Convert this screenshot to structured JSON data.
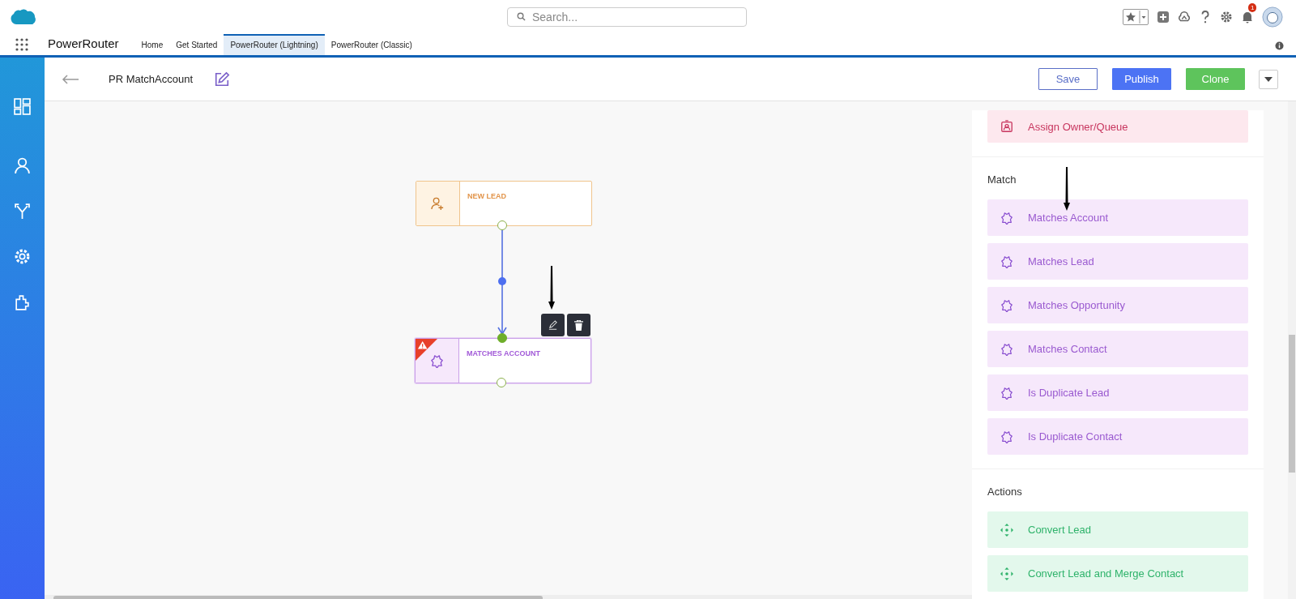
{
  "header": {
    "search_placeholder": "Search...",
    "notification_count": "1"
  },
  "nav": {
    "app_name": "PowerRouter",
    "tabs": [
      {
        "label": "Home",
        "selected": false
      },
      {
        "label": "Get Started",
        "selected": false
      },
      {
        "label": "PowerRouter (Lightning)",
        "selected": true
      },
      {
        "label": "PowerRouter (Classic)",
        "selected": false
      }
    ]
  },
  "toolbar": {
    "title": "PR MatchAccount",
    "buttons": [
      {
        "label": "Save",
        "kind": "outline"
      },
      {
        "label": "Publish",
        "kind": "primary"
      },
      {
        "label": "Clone",
        "kind": "success"
      }
    ]
  },
  "canvas": {
    "nodes": [
      {
        "label": "NEW LEAD",
        "kind": "lead",
        "warning": false,
        "selected": false
      },
      {
        "label": "MATCHES ACCOUNT",
        "kind": "match",
        "warning": true,
        "selected": true
      }
    ]
  },
  "panel": {
    "sections": [
      {
        "items": [
          {
            "label": "Assign Owner/Queue",
            "kind": "assign"
          }
        ]
      },
      {
        "title": "Match",
        "items": [
          {
            "label": "Matches Account",
            "kind": "match"
          },
          {
            "label": "Matches Lead",
            "kind": "match"
          },
          {
            "label": "Matches Opportunity",
            "kind": "match"
          },
          {
            "label": "Matches Contact",
            "kind": "match"
          },
          {
            "label": "Is Duplicate Lead",
            "kind": "match"
          },
          {
            "label": "Is Duplicate Contact",
            "kind": "match"
          }
        ]
      },
      {
        "title": "Actions",
        "items": [
          {
            "label": "Convert Lead",
            "kind": "action"
          },
          {
            "label": "Convert Lead and Merge Contact",
            "kind": "action"
          }
        ]
      }
    ]
  }
}
